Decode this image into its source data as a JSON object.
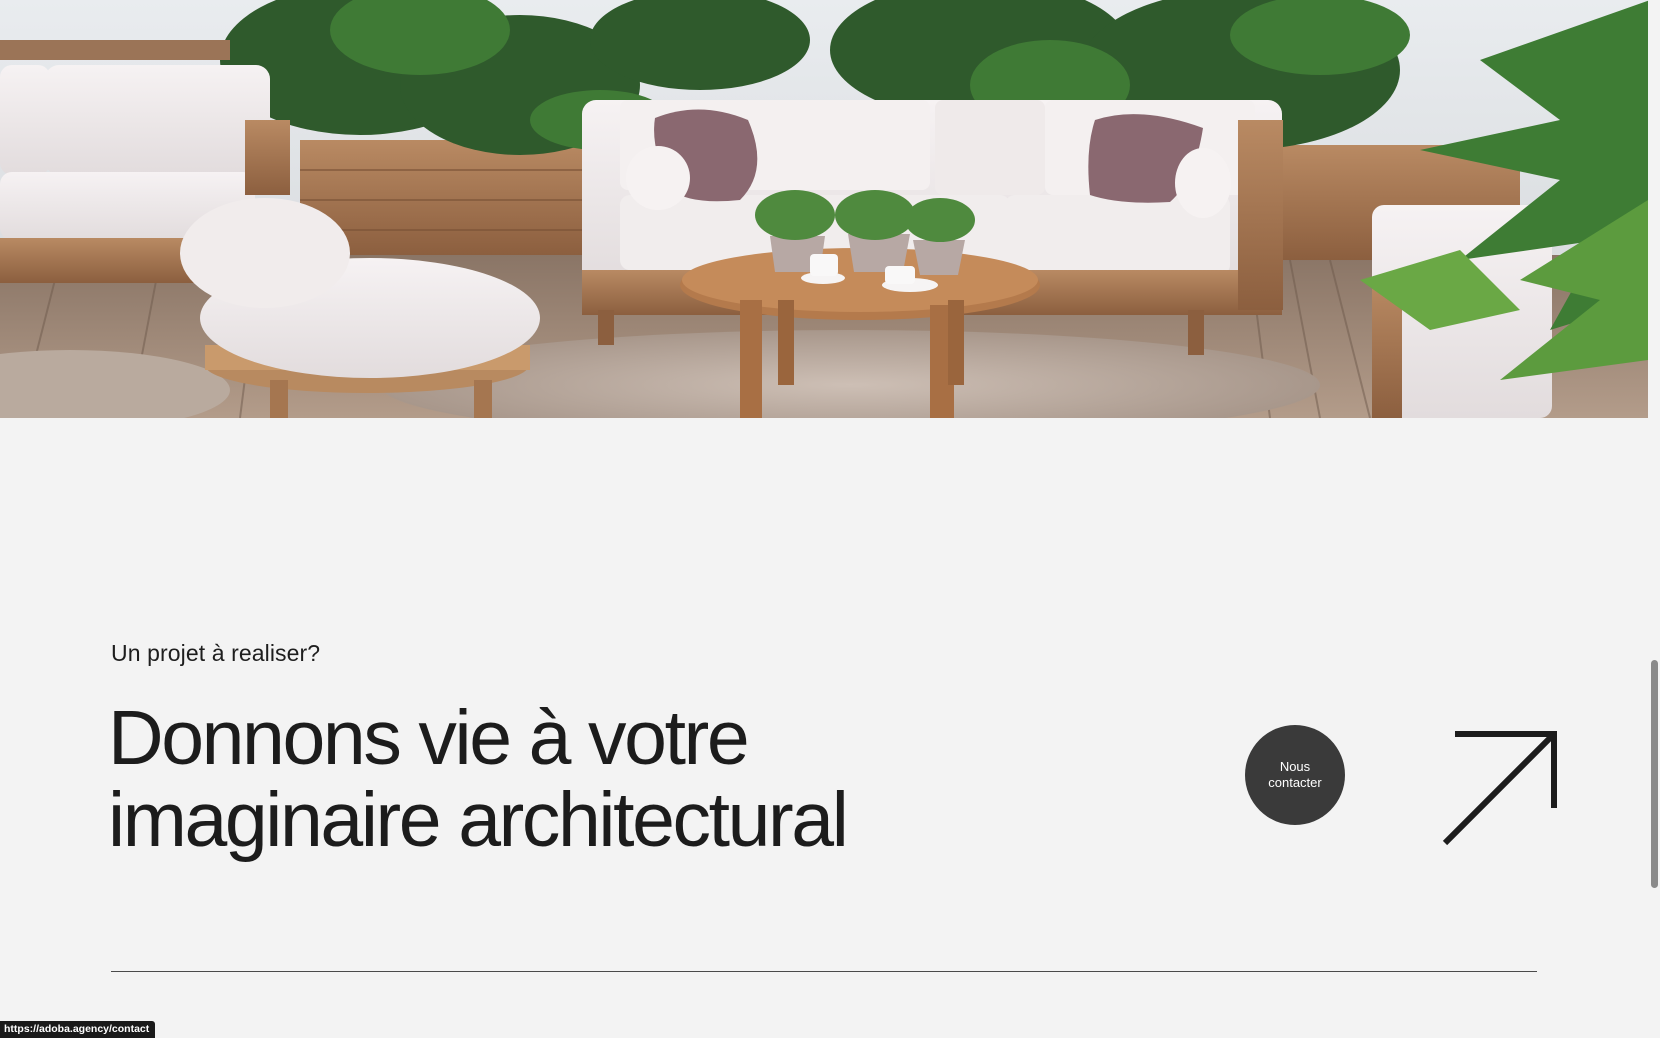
{
  "hero": {
    "image_subject": "outdoor-lounge-photo"
  },
  "cta": {
    "kicker": "Un projet à realiser?",
    "headline_line1": "Donnons vie à votre",
    "headline_line2": "imaginaire architectural",
    "contact_button_label": "Nous contacter",
    "contact_button_color": "#3a3a3a",
    "arrow_icon": "arrow-up-right-icon"
  },
  "status_bar": {
    "url": "https://adoba.agency/contact"
  },
  "colors": {
    "background": "#f3f3f3",
    "text": "#1c1c1c"
  }
}
